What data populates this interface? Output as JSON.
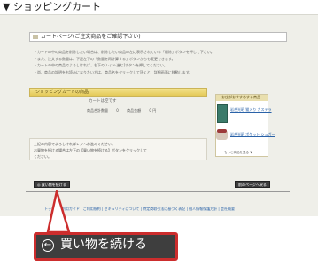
{
  "page": {
    "heading": "▼ ショッピングカート"
  },
  "cart": {
    "title": "カートページ(ご注文商品をご確認下さい)",
    "instructions": [
      "・カートの中の商品を削除したい場合は、削除したい商品の左に表示されている「削除」ボタンを押して下さい。",
      "・また、注文する数量は、下記左下の「数量を再計算する」ボタンからも変更できます。",
      "・カートの中の商品でよろしければ、右下の[レジへ進む]ボタンを押してください。",
      "・尚、商品の説明をお読みになりたい方は、商品名をクリックして頂くと、詳細画面に移動します。"
    ],
    "section_title": "ショッピングカートの商品",
    "empty_notice": "カートは空です",
    "totals": {
      "count_label": "商品合計数量",
      "count_value": "0",
      "price_label": "商品金額",
      "price_value": "0 円"
    },
    "messages": [
      "上記の内容でよろしければレジへお進みください。",
      "お買物を続ける場合は左下の【買い物を続ける】ボタンをクリックして",
      "ください。"
    ]
  },
  "recommend": {
    "header": "お店がおすすめする商品",
    "item1": "岩合光昭 猫入り カステラ",
    "item2": "岩合光昭 ポケット シュガー",
    "more": "もっと商品を見る ▼"
  },
  "buttons": {
    "back_small": "◎ 買い物を続ける",
    "next_small": "前のページへ戻る",
    "continue": "買い物を続ける",
    "continue_icon": "←"
  },
  "footer": {
    "links": "トップ | ご利用ガイド | ご利用規約 | セキュリティについて | 特定商取引法に基づく表記 | 個人情報保護方針 | 会社概要"
  },
  "colors": {
    "button_bg": "#3e3e3e",
    "callout_border": "#cc2d2d",
    "section_bar": "#e4c958",
    "link": "#2a62a8"
  }
}
